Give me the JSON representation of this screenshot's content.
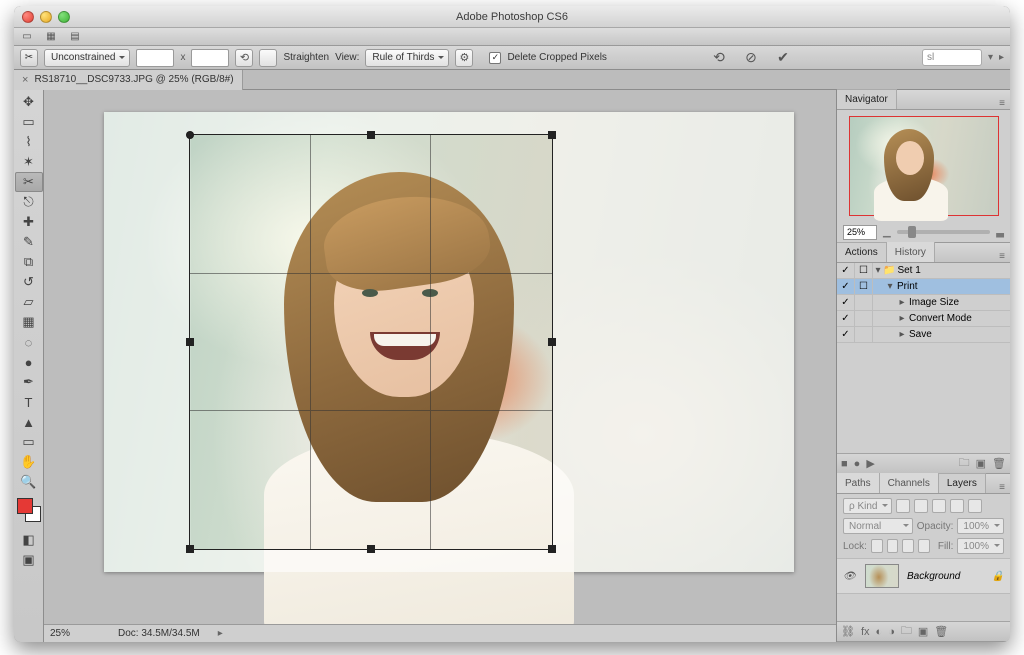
{
  "app_title": "Adobe Photoshop CS6",
  "document": {
    "tab_label": "RS18710__DSC9733.JPG @ 25% (RGB/8#)"
  },
  "options_bar": {
    "aspect_mode": "Unconstrained",
    "width_value": "",
    "height_value": "",
    "straighten_label": "Straighten",
    "view_label": "View:",
    "view_mode": "Rule of Thirds",
    "delete_cropped_label": "Delete Cropped Pixels",
    "delete_cropped_checked": "✓",
    "search_placeholder": "sl"
  },
  "status": {
    "zoom": "25%",
    "doc_size": "Doc: 34.5M/34.5M"
  },
  "navigator": {
    "tab": "Navigator",
    "zoom": "25%"
  },
  "actions": {
    "tabs": {
      "actions": "Actions",
      "history": "History"
    },
    "rows": [
      {
        "chk": "✓",
        "mod": "☐",
        "indent": 0,
        "twist": "▾",
        "icon": "📁",
        "label": "Set 1",
        "selected": false
      },
      {
        "chk": "✓",
        "mod": "☐",
        "indent": 1,
        "twist": "▾",
        "icon": "",
        "label": "Print",
        "selected": true
      },
      {
        "chk": "✓",
        "mod": "",
        "indent": 2,
        "twist": "▸",
        "icon": "",
        "label": "Image Size",
        "selected": false
      },
      {
        "chk": "✓",
        "mod": "",
        "indent": 2,
        "twist": "▸",
        "icon": "",
        "label": "Convert Mode",
        "selected": false
      },
      {
        "chk": "✓",
        "mod": "",
        "indent": 2,
        "twist": "▸",
        "icon": "",
        "label": "Save",
        "selected": false
      }
    ]
  },
  "layers": {
    "tabs": {
      "paths": "Paths",
      "channels": "Channels",
      "layers": "Layers"
    },
    "kind_label": "ρ Kind",
    "blend_mode": "Normal",
    "opacity_label": "Opacity:",
    "opacity_value": "100%",
    "lock_label": "Lock:",
    "fill_label": "Fill:",
    "fill_value": "100%",
    "layer_name": "Background"
  }
}
